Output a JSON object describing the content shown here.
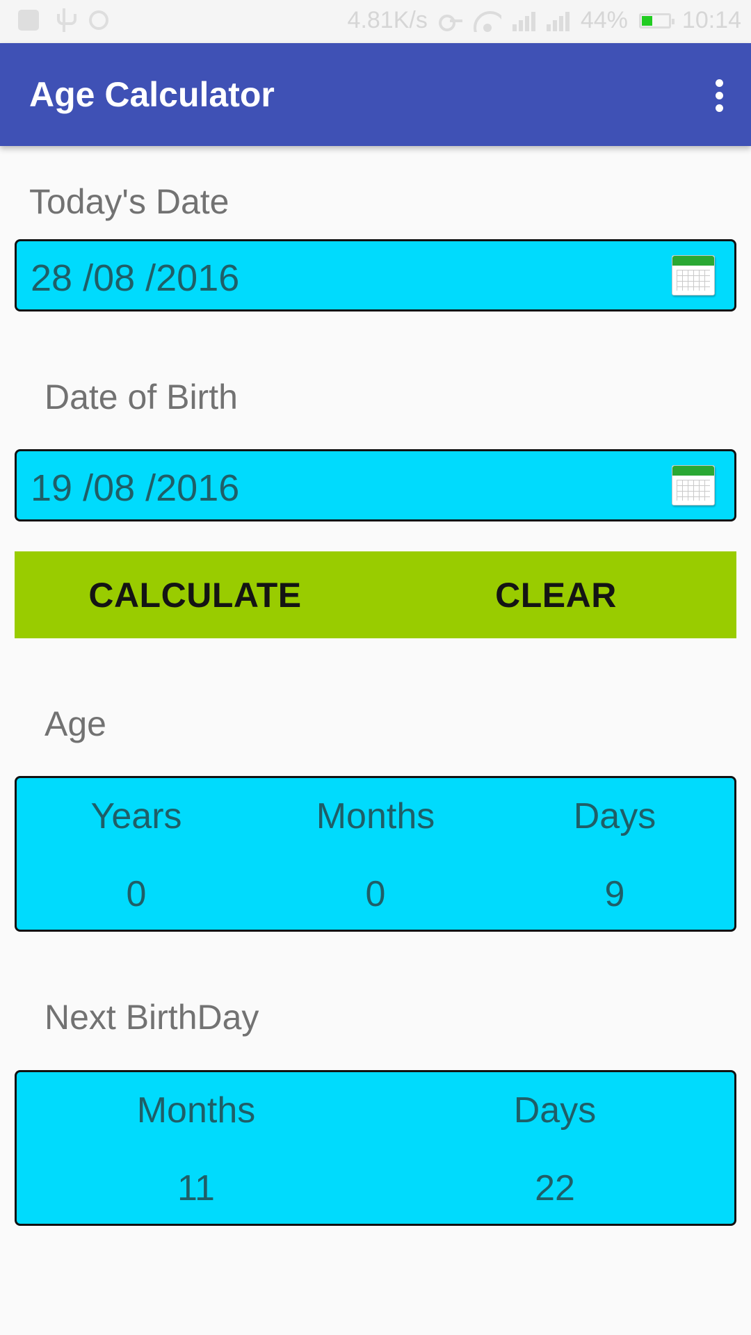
{
  "status_bar": {
    "net_speed": "4.81K/s",
    "battery_percent": "44%",
    "time": "10:14",
    "battery_level": 0.44,
    "battery_color": "#22cc22"
  },
  "app_bar": {
    "title": "Age Calculator",
    "background": "#3f51b5",
    "menu_icon": "overflow-menu-icon"
  },
  "today": {
    "label": "Today's Date",
    "value": "28 /08 /2016",
    "icon": "calendar-icon"
  },
  "birth": {
    "label": "Date of Birth",
    "value": "19 /08 /2016",
    "icon": "calendar-icon"
  },
  "actions": {
    "calculate": "CALCULATE",
    "clear": "CLEAR",
    "background": "#99cc00"
  },
  "age": {
    "label": "Age",
    "columns": [
      {
        "header": "Years",
        "value": "0"
      },
      {
        "header": "Months",
        "value": "0"
      },
      {
        "header": "Days",
        "value": "9"
      }
    ]
  },
  "next_birthday": {
    "label": "Next BirthDay",
    "columns": [
      {
        "header": "Months",
        "value": "11"
      },
      {
        "header": "Days",
        "value": "22"
      }
    ]
  },
  "colors": {
    "field_background": "#00dbfd",
    "field_text": "#1f5e67",
    "label_text": "#727272"
  }
}
